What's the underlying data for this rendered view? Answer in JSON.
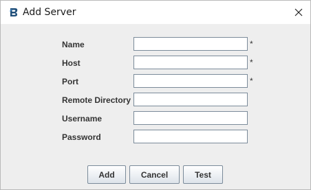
{
  "window": {
    "title": "Add Server"
  },
  "form": {
    "fields": [
      {
        "label": "Name",
        "value": "",
        "required": "*"
      },
      {
        "label": "Host",
        "value": "",
        "required": "*"
      },
      {
        "label": "Port",
        "value": "",
        "required": "*"
      },
      {
        "label": "Remote Directory",
        "value": ""
      },
      {
        "label": "Username",
        "value": ""
      },
      {
        "label": "Password",
        "value": ""
      }
    ]
  },
  "buttons": {
    "add": "Add",
    "cancel": "Cancel",
    "test": "Test"
  },
  "icons": {
    "app": "app-logo-icon",
    "close": "close-icon"
  },
  "colors": {
    "app_icon": "#1f4e79",
    "dialog_background": "#eeeeee",
    "field_border": "#7a8a99"
  }
}
